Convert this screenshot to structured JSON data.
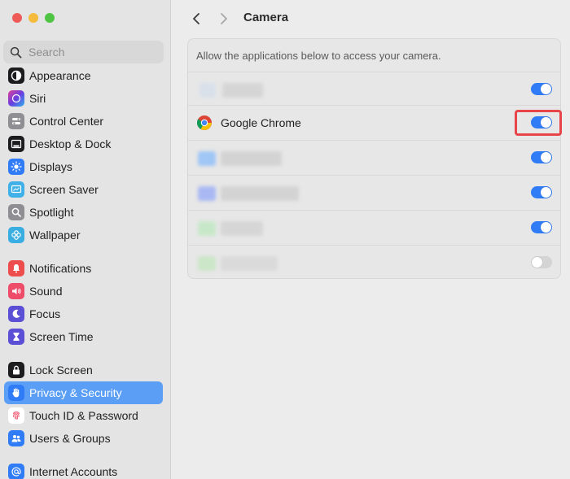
{
  "window": {
    "title": "Camera",
    "traffic_colors": [
      "#ee5b57",
      "#f5bb3d",
      "#4fc443"
    ]
  },
  "search": {
    "placeholder": "Search"
  },
  "sidebar": {
    "items": [
      {
        "label": "Appearance",
        "icon": "appearance-icon",
        "color": "#1c1c1e"
      },
      {
        "label": "Siri",
        "icon": "siri-icon",
        "color": "#8a3ad6"
      },
      {
        "label": "Control Center",
        "icon": "control-center-icon",
        "color": "#8e8e93"
      },
      {
        "label": "Desktop & Dock",
        "icon": "desktop-dock-icon",
        "color": "#1c1c1e"
      },
      {
        "label": "Displays",
        "icon": "displays-icon",
        "color": "#2f7cf6"
      },
      {
        "label": "Screen Saver",
        "icon": "screen-saver-icon",
        "color": "#3fb1e8"
      },
      {
        "label": "Spotlight",
        "icon": "spotlight-icon",
        "color": "#8e8e93"
      },
      {
        "label": "Wallpaper",
        "icon": "wallpaper-icon",
        "color": "#3aaee0"
      },
      {
        "label": "Notifications",
        "icon": "notifications-icon",
        "color": "#ee4d4d"
      },
      {
        "label": "Sound",
        "icon": "sound-icon",
        "color": "#ee4d6a"
      },
      {
        "label": "Focus",
        "icon": "focus-icon",
        "color": "#5b4fd6"
      },
      {
        "label": "Screen Time",
        "icon": "screen-time-icon",
        "color": "#5b4fd6"
      },
      {
        "label": "Lock Screen",
        "icon": "lock-screen-icon",
        "color": "#1c1c1e"
      },
      {
        "label": "Privacy & Security",
        "icon": "privacy-hand-icon",
        "color": "#2f7cf6",
        "active": true
      },
      {
        "label": "Touch ID & Password",
        "icon": "fingerprint-icon",
        "color": "#ffffff"
      },
      {
        "label": "Users & Groups",
        "icon": "users-icon",
        "color": "#2f7cf6"
      },
      {
        "label": "Internet Accounts",
        "icon": "at-icon",
        "color": "#2f7cf6"
      }
    ]
  },
  "main": {
    "description": "Allow the applications below to access your camera.",
    "apps": [
      {
        "name": "",
        "enabled": true
      },
      {
        "name": "Google Chrome",
        "enabled": true,
        "icon": "chrome-icon"
      },
      {
        "name": "",
        "enabled": true
      },
      {
        "name": "",
        "enabled": true
      },
      {
        "name": "",
        "enabled": true
      },
      {
        "name": "",
        "enabled": false
      }
    ]
  },
  "colors": {
    "accent": "#2f7cf6",
    "selection": "#5a9ef5",
    "highlight": "#e8454a"
  }
}
